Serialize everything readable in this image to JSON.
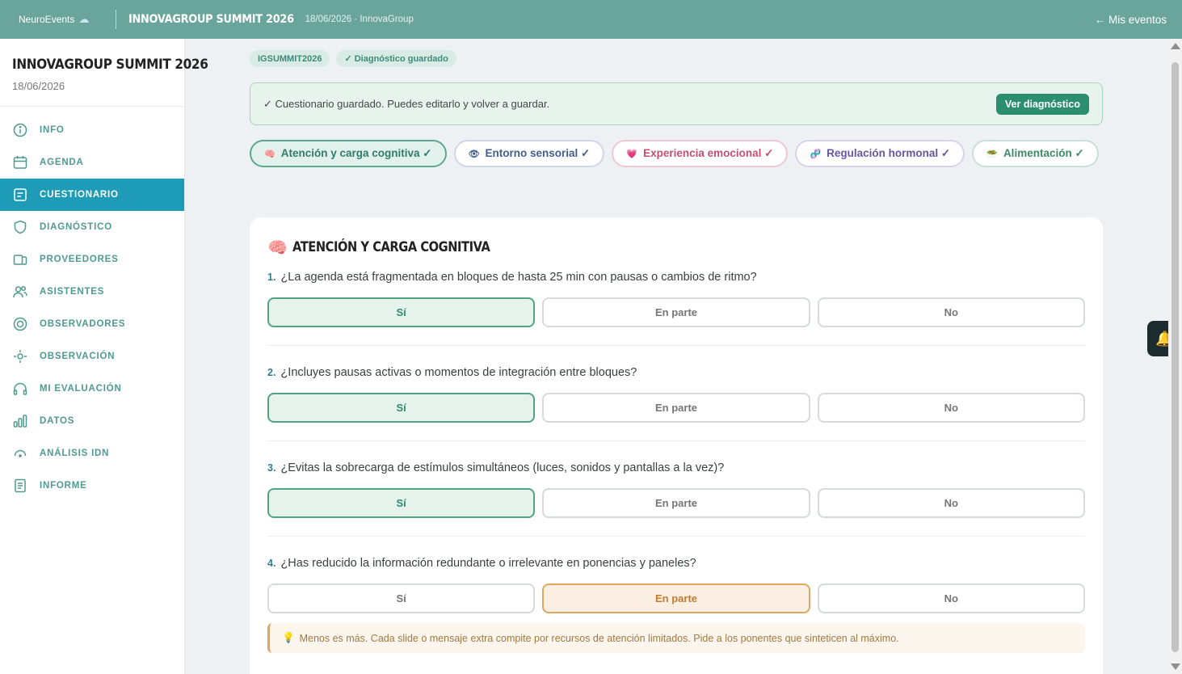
{
  "topbar": {
    "brand": "NeuroEvents",
    "brand_icon": "brain-icon",
    "title": "INNOVAGROUP SUMMIT 2026",
    "subtitle": "18/06/2026 · InnovaGroup",
    "back_link": "← Mis eventos"
  },
  "sidebar": {
    "title": "INNOVAGROUP SUMMIT 2026",
    "date": "18/06/2026",
    "items": [
      {
        "label": "INFO",
        "icon": "info-icon"
      },
      {
        "label": "AGENDA",
        "icon": "calendar-icon"
      },
      {
        "label": "CUESTIONARIO",
        "icon": "form-icon",
        "active": true
      },
      {
        "label": "DIAGNÓSTICO",
        "icon": "shield-icon"
      },
      {
        "label": "PROVEEDORES",
        "icon": "cards-icon"
      },
      {
        "label": "ASISTENTES",
        "icon": "users-icon"
      },
      {
        "label": "OBSERVADORES",
        "icon": "target-icon"
      },
      {
        "label": "OBSERVACIÓN",
        "icon": "crosshair-icon"
      },
      {
        "label": "MI EVALUACIÓN",
        "icon": "headphones-icon"
      },
      {
        "label": "DATOS",
        "icon": "bar-chart-icon"
      },
      {
        "label": "ANÁLISIS IDN",
        "icon": "gauge-icon"
      },
      {
        "label": "INFORME",
        "icon": "document-icon"
      }
    ]
  },
  "chips": {
    "code": "IGSUMMIT2026",
    "status": "✓ Diagnóstico guardado"
  },
  "banner": {
    "text": "✓ Cuestionario guardado. Puedes editarlo y volver a guardar.",
    "button": "Ver diagnóstico"
  },
  "tabs": [
    {
      "label": "Atención y carga cognitiva ✓",
      "icon": "brain-icon",
      "glyph": "🧠"
    },
    {
      "label": "Entorno sensorial ✓",
      "icon": "eye-icon",
      "glyph": "👁"
    },
    {
      "label": "Experiencia emocional ✓",
      "icon": "heart-icon",
      "glyph": "💗"
    },
    {
      "label": "Regulación hormonal ✓",
      "icon": "dna-icon",
      "glyph": "🧬"
    },
    {
      "label": "Alimentación ✓",
      "icon": "salad-icon",
      "glyph": "🥗"
    }
  ],
  "section": {
    "icon": "brain-icon",
    "glyph": "🧠",
    "title": "ATENCIÓN Y CARGA COGNITIVA"
  },
  "options": {
    "yes": "Sí",
    "partial": "En parte",
    "no": "No"
  },
  "questions": [
    {
      "num": "1.",
      "text": "¿La agenda está fragmentada en bloques de hasta 25 min con pausas o cambios de ritmo?",
      "answer": "yes"
    },
    {
      "num": "2.",
      "text": "¿Incluyes pausas activas o momentos de integración entre bloques?",
      "answer": "yes"
    },
    {
      "num": "3.",
      "text": "¿Evitas la sobrecarga de estímulos simultáneos (luces, sonidos y pantallas a la vez)?",
      "answer": "yes"
    },
    {
      "num": "4.",
      "text": "¿Has reducido la información redundante o irrelevante en ponencias y paneles?",
      "answer": "partial"
    }
  ],
  "tip": {
    "icon": "lightbulb-icon",
    "glyph": "💡",
    "text": "Menos es más. Cada slide o mensaje extra compite por recursos de atención limitados. Pide a los ponentes que sinteticen al máximo."
  },
  "notification": {
    "icon": "bell-icon",
    "glyph": "🔔"
  },
  "colors": {
    "topbar": "#6aa59c",
    "active_nav": "#1e9bb6",
    "accent_green": "#2b8f6f",
    "partial_orange": "#dfa75f"
  }
}
